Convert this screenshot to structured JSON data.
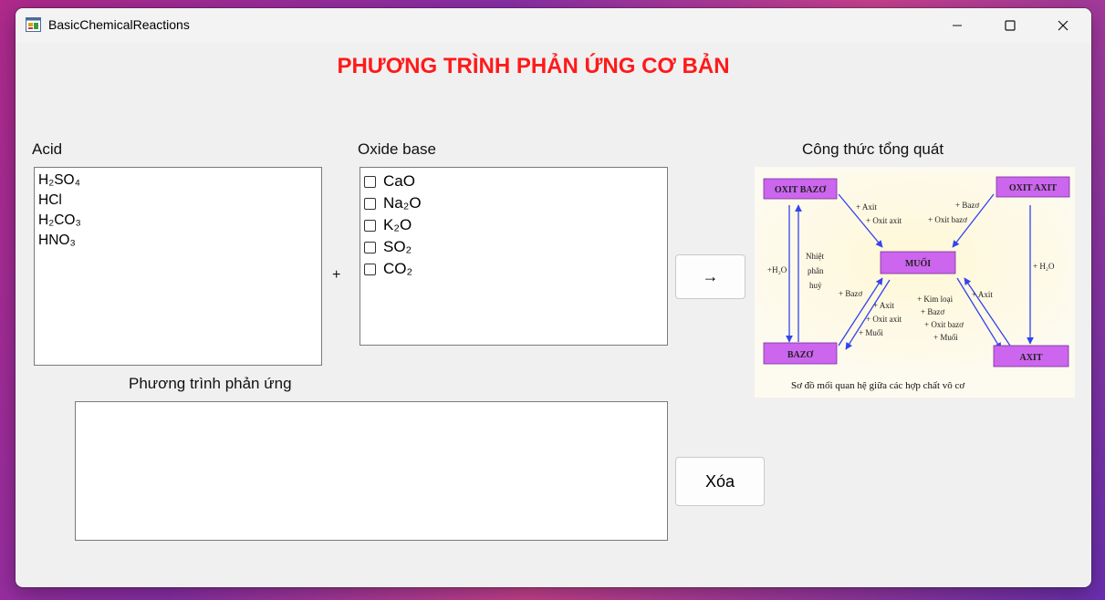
{
  "window": {
    "title": "BasicChemicalReactions"
  },
  "heading": "PHƯƠNG TRÌNH PHẢN ỨNG CƠ BẢN",
  "acid": {
    "label": "Acid",
    "items": [
      "H₂SO₄",
      "HCl",
      "H₂CO₃",
      "HNO₃"
    ]
  },
  "plus_sign": "+",
  "oxide_base": {
    "label": "Oxide base",
    "items": [
      "CaO",
      "Na₂O",
      "K₂O",
      "SO₂",
      "CO₂"
    ]
  },
  "arrow_button": {
    "label": "→"
  },
  "formula_label": "Công thức tổng quát",
  "reaction": {
    "label": "Phương trình phản ứng",
    "value": ""
  },
  "clear_button": {
    "label": "Xóa"
  },
  "diagram": {
    "boxes": {
      "oxit_bazo": "OXIT BAZƠ",
      "oxit_axit": "OXIT AXIT",
      "muoi": "MUỐI",
      "bazo": "BAZƠ",
      "axit": "AXIT"
    },
    "labels": {
      "t1": "+ Axit",
      "t2": "+ Oxit axit",
      "t3": "+ Bazơ",
      "t4": "+ Oxit bazơ",
      "h2o_left": "+H₂O",
      "nhiet1": "Nhiệt",
      "nhiet2": "phân",
      "nhiet3": "huỷ",
      "h2o_right": "+ H₂O",
      "l1": "+ Bazơ",
      "l2": "+ Axit",
      "l3": "+ Oxit axit",
      "l4": "+ Muối",
      "r1": "+ Kim loại",
      "r2": "+ Bazơ",
      "r3": "+ Oxit bazơ",
      "r4": "+ Muối",
      "r5": "+ Axit"
    },
    "caption": "Sơ đồ mối quan hệ giữa các hợp chất vô cơ",
    "colors": {
      "box_fill": "#cc66ee",
      "arrow": "#3344ee"
    }
  }
}
